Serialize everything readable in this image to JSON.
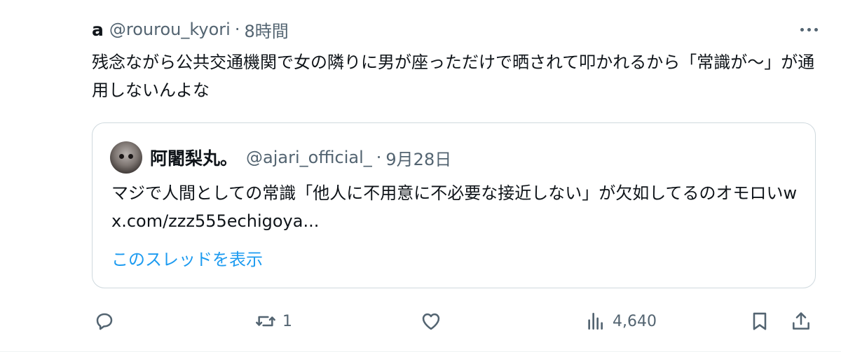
{
  "tweet": {
    "author_name": "a",
    "handle": "@rourou_kyori",
    "separator": "·",
    "time": "8時間",
    "text": "残念ながら公共交通機関で女の隣りに男が座っただけで晒されて叩かれるから「常識が〜」が通用しないんよな",
    "more_icon": "more-icon"
  },
  "quote": {
    "author_name": "阿闍梨丸。",
    "handle": "@ajari_official_",
    "separator": "·",
    "date": "9月28日",
    "text": "マジで人間としての常識「他人に不用意に不必要な接近しない」が欠如してるのオモロいw x.com/zzz555echigoya...",
    "show_thread": "このスレッドを表示"
  },
  "actions": {
    "reply_icon": "reply-icon",
    "repost_icon": "repost-icon",
    "repost_count": "1",
    "like_icon": "like-icon",
    "views_icon": "views-icon",
    "views_count": "4,640",
    "bookmark_icon": "bookmark-icon",
    "share_icon": "share-icon"
  },
  "colors": {
    "text": "#0f1419",
    "secondary": "#536471",
    "link": "#1d9bf0",
    "border": "#cfd9de"
  }
}
